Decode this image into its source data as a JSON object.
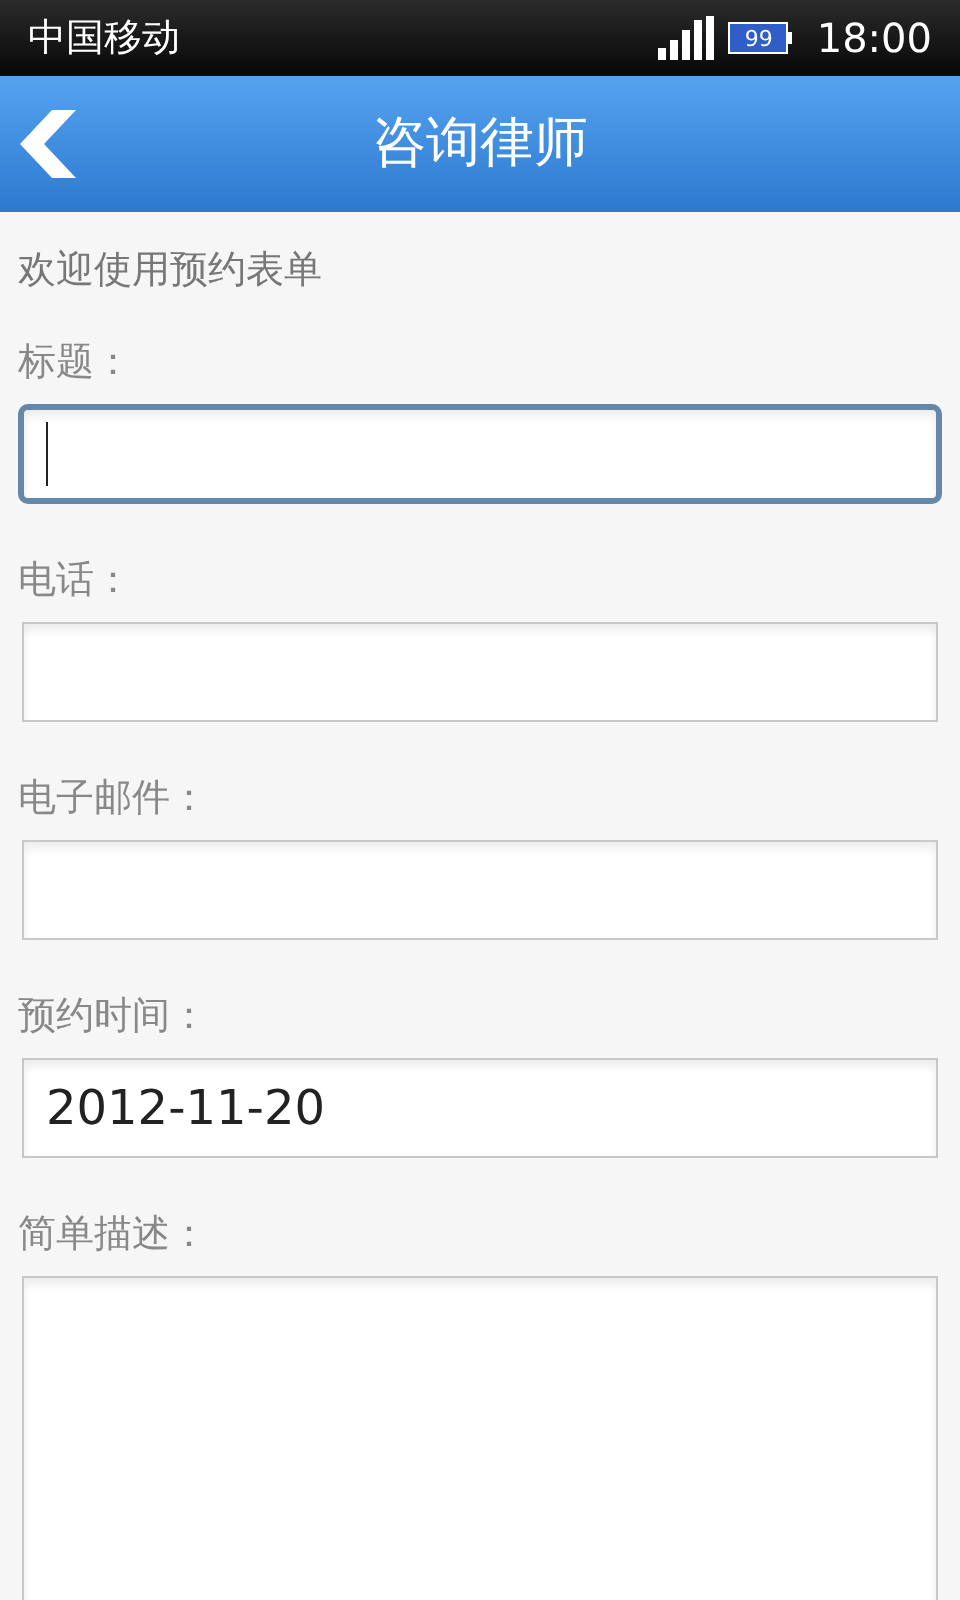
{
  "status_bar": {
    "carrier": "中国移动",
    "battery": "99",
    "time": "18:00"
  },
  "header": {
    "title": "咨询律师"
  },
  "intro": "欢迎使用预约表单",
  "fields": [
    {
      "label": "标题：",
      "kind": "input",
      "focused": true
    },
    {
      "label": "电话：",
      "kind": "input",
      "focused": false
    },
    {
      "label": "电子邮件：",
      "kind": "input",
      "focused": false
    },
    {
      "label": "预约时间：",
      "kind": "input",
      "value": "2012-11-20",
      "focused": false
    },
    {
      "label": "简单描述：",
      "kind": "textarea",
      "focused": false
    }
  ]
}
